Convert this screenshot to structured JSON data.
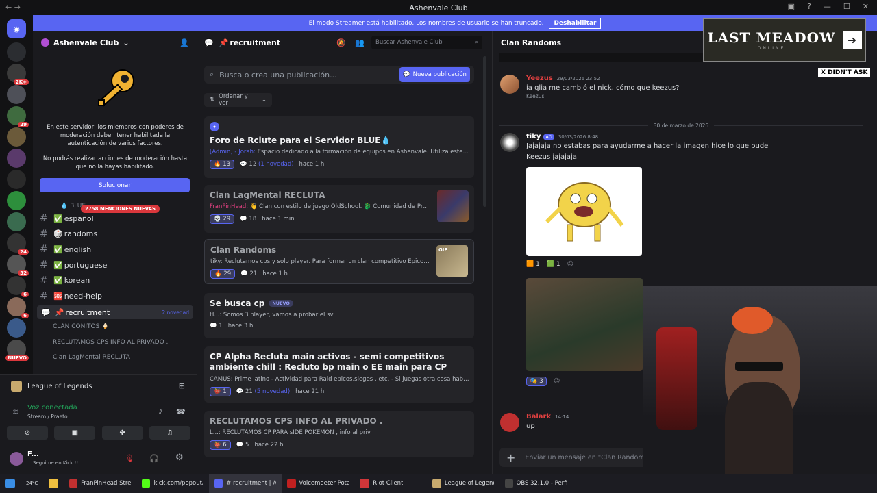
{
  "window": {
    "title": "Ashenvale Club"
  },
  "banner": {
    "text": "El modo Streamer está habilitado. Los nombres de usuario se han truncado.",
    "button": "Deshabilitar"
  },
  "servers": [
    {
      "badge": "",
      "color": "#2b2d31"
    },
    {
      "badge": "2K+",
      "color": "#3a3a3a"
    },
    {
      "badge": "",
      "color": "#4e5058"
    },
    {
      "badge": "29",
      "color": "#3f6b3f"
    },
    {
      "badge": "",
      "color": "#6b5a3a"
    },
    {
      "badge": "",
      "color": "#5a3a6b"
    },
    {
      "badge": "",
      "color": "#2a2a2a"
    },
    {
      "badge": "",
      "color": "#2d8f3c"
    },
    {
      "badge": "",
      "color": "#3a6b4f"
    },
    {
      "badge": "24",
      "color": "#333"
    },
    {
      "badge": "32",
      "color": "#555"
    },
    {
      "badge": "6",
      "color": "#333"
    },
    {
      "badge": "6",
      "color": "#8a6a5a"
    },
    {
      "badge": "",
      "color": "#3a5a8a"
    },
    {
      "badge": "NUEVO",
      "color": "#4a4a4a"
    }
  ],
  "server": {
    "name": "Ashenvale Club",
    "notice": "En este servidor, los miembros con poderes de moderación deben tener habilitada la autenticación de varios factores.",
    "notice2": "No podrás realizar acciones de moderación hasta que no la hayas habilitado.",
    "solve": "Solucionar",
    "mentions": "2758 MENCIONES NUEVAS",
    "blue": "💧 BLUE"
  },
  "channels": [
    {
      "name": "español",
      "prefix": "✅"
    },
    {
      "name": "randoms",
      "prefix": "🎲"
    },
    {
      "name": "english",
      "prefix": "✅"
    },
    {
      "name": "portuguese",
      "prefix": "✅"
    },
    {
      "name": "korean",
      "prefix": "✅"
    },
    {
      "name": "need-help",
      "prefix": "🆘"
    }
  ],
  "activeChannel": {
    "name": "recruitment",
    "prefix": "📌",
    "tag": "2 novedad"
  },
  "threads": [
    "CLAN CONITOS 🍦",
    "RECLUTAMOS CPS INFO AL PRIVADO .",
    "Clan LagMental RECLUTA"
  ],
  "voice": {
    "game": "League of Legends",
    "status": "Voz conectada",
    "detail": "Stream / Praeto",
    "user": "F...",
    "userStatus": "Seguime en Kick !!!"
  },
  "forum": {
    "channel": "recruitment",
    "search": "Buscar Ashenvale Club",
    "postSearch": "Busca o crea una publicación...",
    "newPost": "Nueva publicación",
    "sort": "Ordenar y ver",
    "posts": [
      {
        "title": "Foro de Rclute para el Servidor BLUE💧",
        "author": "[Admin] - Jorah:",
        "text": "Espacio dedicado a la formación de equipos en Ashenvale. Utiliza este cana...",
        "react": "13",
        "replies": "12",
        "novedad": "(1 novedad)",
        "time": "hace 1 h"
      },
      {
        "title": "Clan LagMental RECLUTA",
        "author": "FranPinHead:",
        "text": "👋 Clan con estilo de juego OldSchool. 🐉 Comunidad de Praet...",
        "react": "29",
        "replies": "18",
        "novedad": "",
        "time": "hace 1 min"
      },
      {
        "title": "Clan Randoms",
        "author": "tiky:",
        "text": "Reclutamos cps y solo player. Para formar un clan competitivo Epicos, Rai...",
        "react": "29",
        "replies": "21",
        "novedad": "",
        "time": "hace 1 h"
      },
      {
        "title": "Se busca cp",
        "tag": "NUEVO",
        "author": "H...:",
        "text": "Somos 3 player, vamos a probar el sv",
        "react": "",
        "replies": "1",
        "novedad": "",
        "time": "hace 3 h"
      },
      {
        "title": "CP Alpha Recluta main activos - semi competitivos ambiente chill : Recluto bp main o EE main para CP",
        "author": "CAMUS:",
        "text": "Prime latino - Actividad para Raid epicos,sieges , etc. - Si juegas otra cosa hablar ig...",
        "react": "1",
        "replies": "21",
        "novedad": "(5 novedad)",
        "time": "hace 21 h"
      },
      {
        "title": "RECLUTAMOS CPS INFO AL PRIVADO .",
        "author": "L...:",
        "text": "RECLUTAMOS CP PARA sIDE POKEMON , info al priv",
        "react": "6",
        "replies": "5",
        "novedad": "",
        "time": "hace 22 h"
      }
    ]
  },
  "chat": {
    "title": "Clan Randoms",
    "dateDivider": "30 de marzo de 2026",
    "msgs": [
      {
        "user": "Yeezus",
        "time": "29/03/2026 23:52",
        "text": "ia qlia me cambió el nick, cómo que keezus?",
        "extra": "Keezus"
      },
      {
        "user": "tiky",
        "tag": "AO",
        "time": "30/03/2026 8:48",
        "text": "Jajajaja no estabas para ayudarme a hacer la imagen hice lo que pude",
        "text2": "Keezus jajajaja",
        "r1": "1",
        "r2": "1",
        "r3": "3"
      },
      {
        "user": "Balark",
        "time": "14:14",
        "text": "up"
      }
    ],
    "input": "Enviar un mensaje en \"Clan Randoms\""
  },
  "overlay": {
    "brand": "LAST MEADOW",
    "sub": "ONLINE",
    "tag": "X DIDN'T ASK"
  },
  "taskbar": {
    "temp": "24°C",
    "items": [
      "FranPinHead Strea...",
      "kick.com/popout/f...",
      "#·recruitment | As...",
      "Voicemeeter Potato",
      "Riot Client",
      "League of Legends",
      "OBS 32.1.0 - Perfil: ..."
    ]
  }
}
